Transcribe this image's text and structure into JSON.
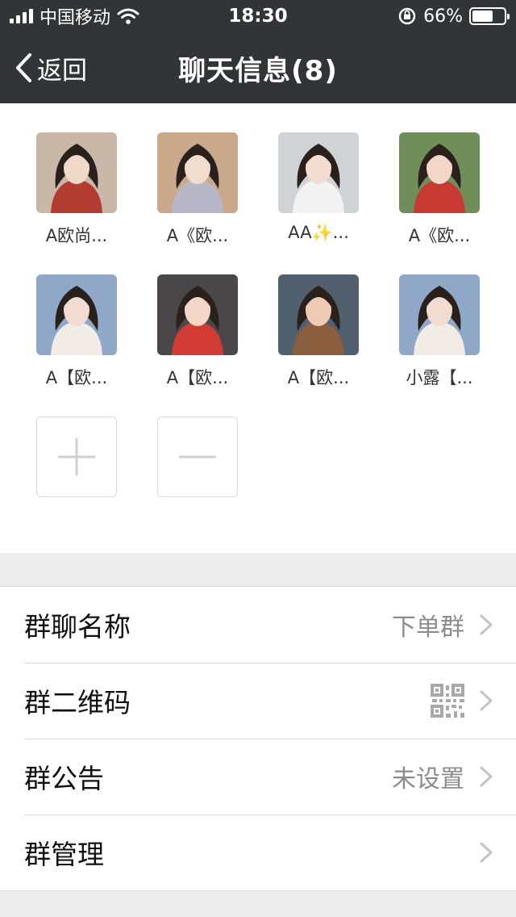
{
  "status_bar": {
    "carrier": "中国移动",
    "time": "18:30",
    "battery": "66%",
    "battery_level": 0.66
  },
  "nav": {
    "back_label": "返回",
    "title": "聊天信息(8)"
  },
  "members": [
    {
      "name": "A欧尚...",
      "avatar_colors": [
        "#c9b8a8",
        "#b33c30",
        "#f1d9c9"
      ]
    },
    {
      "name": "A《欧...",
      "avatar_colors": [
        "#c9a98a",
        "#b7b7c9",
        "#f1dccd"
      ]
    },
    {
      "name": "AA✨...",
      "avatar_colors": [
        "#cfd3d6",
        "#f2f2f2",
        "#f3ddd0"
      ]
    },
    {
      "name": "A《欧...",
      "avatar_colors": [
        "#6f8e5a",
        "#c73a33",
        "#f3d6c8"
      ]
    },
    {
      "name": "A【欧...",
      "avatar_colors": [
        "#8fa8c8",
        "#f1ece6",
        "#f2dbd1"
      ]
    },
    {
      "name": "A【欧...",
      "avatar_colors": [
        "#4a4748",
        "#d23b33",
        "#f2d7c9"
      ]
    },
    {
      "name": "A【欧...",
      "avatar_colors": [
        "#51606f",
        "#8a5e3e",
        "#efcbb6"
      ]
    },
    {
      "name": "小露【...",
      "avatar_colors": [
        "#8fa8c8",
        "#f1ece6",
        "#f2dbd1"
      ]
    }
  ],
  "actions": {
    "add_icon": "plus-icon",
    "remove_icon": "minus-icon"
  },
  "settings": [
    {
      "label": "群聊名称",
      "value": "下单群",
      "icon": ""
    },
    {
      "label": "群二维码",
      "value": "",
      "icon": "qrcode-icon"
    },
    {
      "label": "群公告",
      "value": "未设置",
      "icon": ""
    },
    {
      "label": "群管理",
      "value": "",
      "icon": ""
    }
  ]
}
